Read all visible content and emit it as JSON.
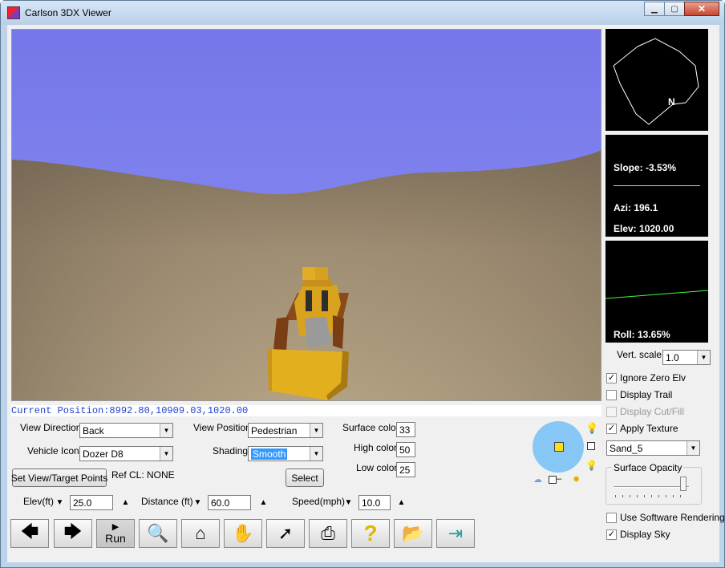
{
  "window": {
    "title": "Carlson 3DX Viewer"
  },
  "status": {
    "position": "Current Position:8992.80,10909.03,1020.00"
  },
  "map_panel": {
    "north_label": "N"
  },
  "info_panel": {
    "slope": "Slope: -3.53%",
    "azi": "Azi: 196.1",
    "elev": "Elev: 1020.00"
  },
  "roll_panel": {
    "roll": "Roll: 13.65%"
  },
  "vert_scale": {
    "label": "Vert. scale",
    "value": "1.0"
  },
  "controls": {
    "view_direction_label": "View Direction",
    "view_direction_value": "Back",
    "vehicle_icon_label": "Vehicle Icon",
    "vehicle_icon_value": "Dozer D8",
    "view_position_label": "View Position",
    "view_position_value": "Pedestrian",
    "shading_label": "Shading",
    "shading_value": "Smooth",
    "set_view_button": "Set View/Target Points",
    "ref_cl": "Ref CL: NONE",
    "select_button": "Select",
    "surface_color_label": "Surface color",
    "surface_color_value": "33",
    "high_color_label": "High color",
    "high_color_value": "50",
    "low_color_label": "Low color",
    "low_color_value": "25",
    "elev_label": "Elev(ft)",
    "elev_value": "25.0",
    "distance_label": "Distance (ft)",
    "distance_value": "60.0",
    "speed_label": "Speed(mph)",
    "speed_value": "10.0"
  },
  "options": {
    "ignore_zero_elv": "Ignore Zero Elv",
    "display_trail": "Display Trail",
    "display_cutfill": "Display Cut/Fill",
    "apply_texture": "Apply Texture",
    "texture_value": "Sand_5",
    "surface_opacity": "Surface Opacity",
    "use_software_rendering": "Use Software Rendering",
    "display_sky": "Display Sky"
  },
  "toolbar": {
    "run_label": "Run"
  },
  "colors": {
    "sky": "#8083ee",
    "sand": "#9e8d72",
    "dozer": "#e0a81e",
    "sun_disc": "#87c7f5",
    "status_text": "#1f3fd0"
  }
}
